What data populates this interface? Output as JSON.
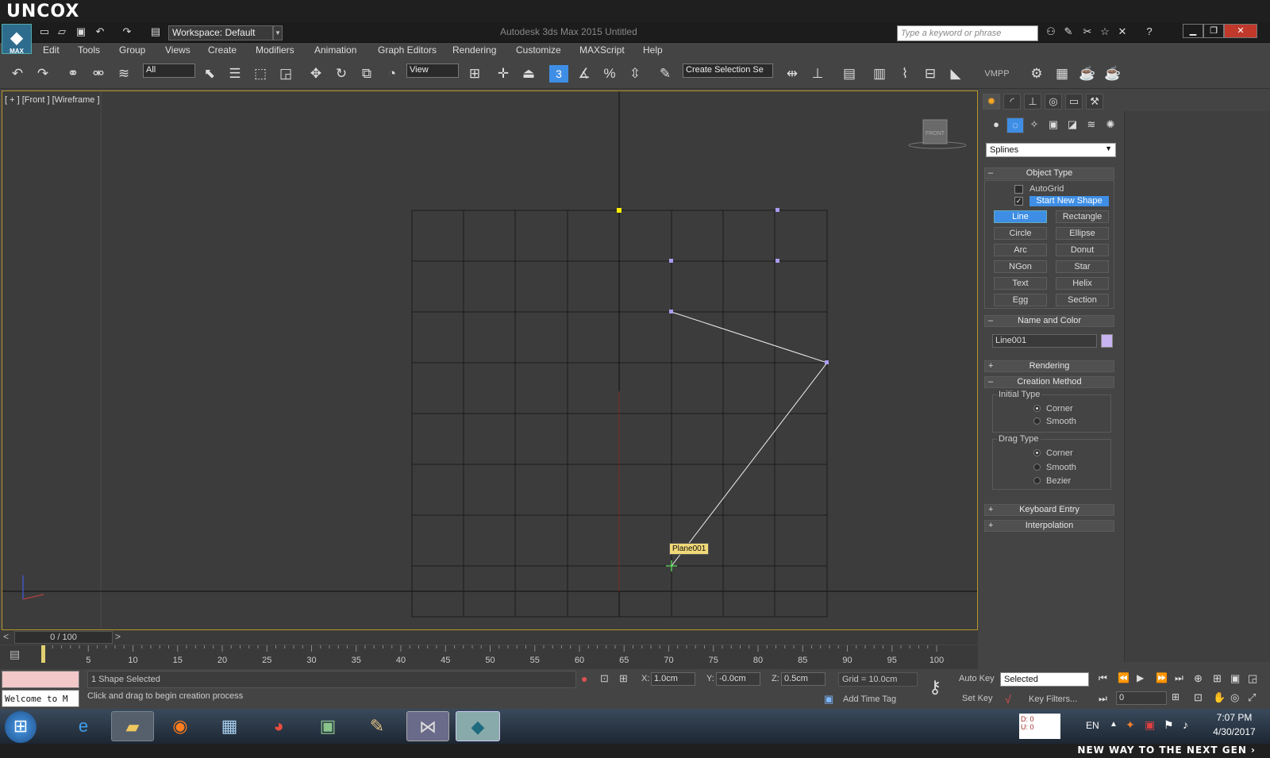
{
  "banner": {
    "logo": "UNCOX",
    "slogan": "NEW WAY TO THE NEXT GEN ›"
  },
  "titlebar": {
    "max_label": "MAX",
    "workspace": "Workspace: Default",
    "app_title": "Autodesk 3ds Max  2015     Untitled",
    "search_placeholder": "Type a keyword or phrase"
  },
  "menu": [
    "Edit",
    "Tools",
    "Group",
    "Views",
    "Create",
    "Modifiers",
    "Animation",
    "Graph Editors",
    "Rendering",
    "Customize",
    "MAXScript",
    "Help"
  ],
  "toolbar": {
    "filter": "All",
    "ref_coord": "View",
    "selection_set": "Create Selection Se",
    "vmpp": "VMPP",
    "snap_label": "3"
  },
  "viewport": {
    "label": "[ + ] [Front ] [Wireframe ]",
    "tooltip": "Plane001",
    "cube_label": "FRONT"
  },
  "panel": {
    "category": "Splines",
    "object_type": "Object Type",
    "autogrid": "AutoGrid",
    "start_new_shape": "Start New Shape",
    "buttons": [
      "Line",
      "Rectangle",
      "Circle",
      "Ellipse",
      "Arc",
      "Donut",
      "NGon",
      "Star",
      "Text",
      "Helix",
      "Egg",
      "Section"
    ],
    "active_button": "Line",
    "name_and_color": "Name and Color",
    "object_name": "Line001",
    "object_color": "#c8b4f0",
    "rendering": "Rendering",
    "creation_method": "Creation Method",
    "initial_type": "Initial Type",
    "initial_options": [
      "Corner",
      "Smooth"
    ],
    "initial_selected": "Corner",
    "drag_type": "Drag Type",
    "drag_options": [
      "Corner",
      "Smooth",
      "Bezier"
    ],
    "drag_selected": "Corner",
    "keyboard_entry": "Keyboard Entry",
    "interpolation": "Interpolation"
  },
  "timeline": {
    "frame": "0 / 100",
    "ticks": [
      "5",
      "10",
      "15",
      "20",
      "25",
      "30",
      "35",
      "40",
      "45",
      "50",
      "55",
      "60",
      "65",
      "70",
      "75",
      "80",
      "85",
      "90",
      "95",
      "100"
    ]
  },
  "status": {
    "selected": "1 Shape Selected",
    "prompt": "Click and drag to begin creation process",
    "welcome": "Welcome to M",
    "x_label": "X:",
    "x": "1.0cm",
    "y_label": "Y:",
    "y": "-0.0cm",
    "z_label": "Z:",
    "z": "0.5cm",
    "grid": "Grid = 10.0cm",
    "add_time_tag": "Add Time Tag",
    "auto_key": "Auto Key",
    "set_key": "Set Key",
    "key_mode": "Selected",
    "key_filters": "Key Filters...",
    "frame_field": "0"
  },
  "taskbar": {
    "lang": "EN",
    "time": "7:07 PM",
    "date": "4/30/2017",
    "meter": "D: 0\nU: 0",
    "max_task": "max"
  },
  "colors": {
    "accent": "#3e8ee5",
    "viewport_border": "#b8952c",
    "tooltip": "#f1d878"
  }
}
